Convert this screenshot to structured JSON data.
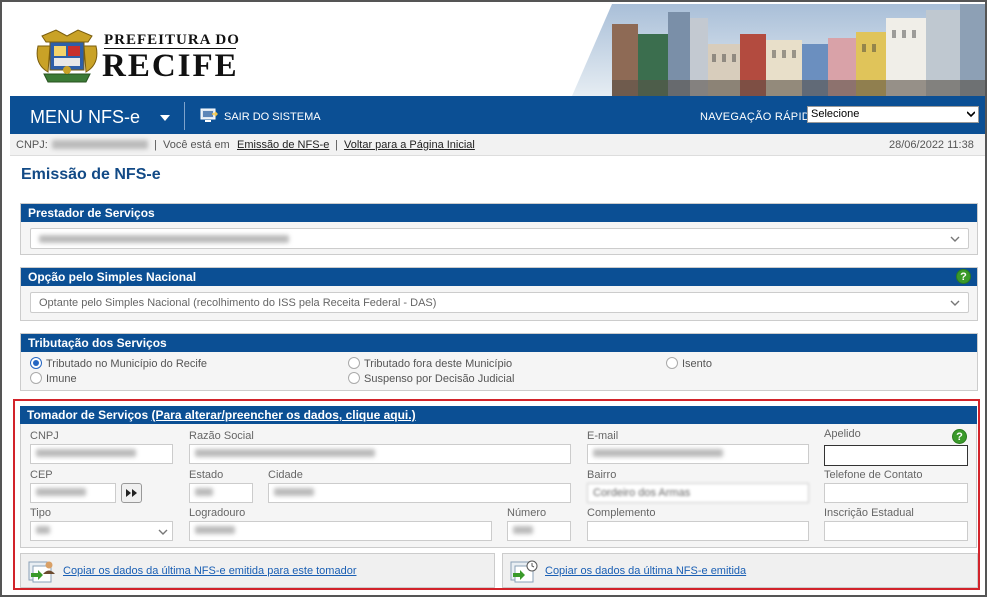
{
  "header": {
    "logo_top": "PREFEITURA DO",
    "logo_main": "RECIFE"
  },
  "nav": {
    "menu_label": "MENU NFS-e",
    "exit_label": "SAIR DO SISTEMA",
    "quick_nav_label": "NAVEGAÇÃO RÁPIDA",
    "quick_nav_value": "Selecione"
  },
  "infobar": {
    "cnpj_label": "CNPJ:",
    "sep": "|",
    "you_are_in": "Você está em",
    "current_page": "Emissão de NFS-e",
    "back_link": "Voltar para a Página Inicial",
    "datetime": "28/06/2022 11:38"
  },
  "page_title": "Emissão de NFS-e",
  "prestador": {
    "title": "Prestador de Serviços"
  },
  "simples": {
    "title": "Opção pelo Simples Nacional",
    "help": "?",
    "value": "Optante pelo Simples Nacional (recolhimento do ISS pela Receita Federal - DAS)"
  },
  "tributacao": {
    "title": "Tributação dos Serviços",
    "options": [
      {
        "label": "Tributado no Município do Recife",
        "checked": true
      },
      {
        "label": "Tributado fora deste Município",
        "checked": false
      },
      {
        "label": "Isento",
        "checked": false
      },
      {
        "label": "Imune",
        "checked": false
      },
      {
        "label": "Suspenso por Decisão Judicial",
        "checked": false
      }
    ]
  },
  "tomador": {
    "title": "Tomador de Serviços",
    "link": "(Para alterar/preencher os dados, clique aqui.)",
    "help": "?",
    "labels": {
      "cnpj": "CNPJ",
      "razao": "Razão Social",
      "email": "E-mail",
      "apelido": "Apelido",
      "cep": "CEP",
      "estado": "Estado",
      "cidade": "Cidade",
      "bairro": "Bairro",
      "telefone": "Telefone de Contato",
      "tipo": "Tipo",
      "logradouro": "Logradouro",
      "numero": "Número",
      "complemento": "Complemento",
      "inscricao": "Inscrição Estadual"
    },
    "values": {
      "bairro": "Cordeiro dos Armas"
    }
  },
  "copy": {
    "tomador": "Copiar os dados da última NFS-e emitida para este tomador",
    "last": "Copiar os dados da última NFS-e emitida"
  }
}
